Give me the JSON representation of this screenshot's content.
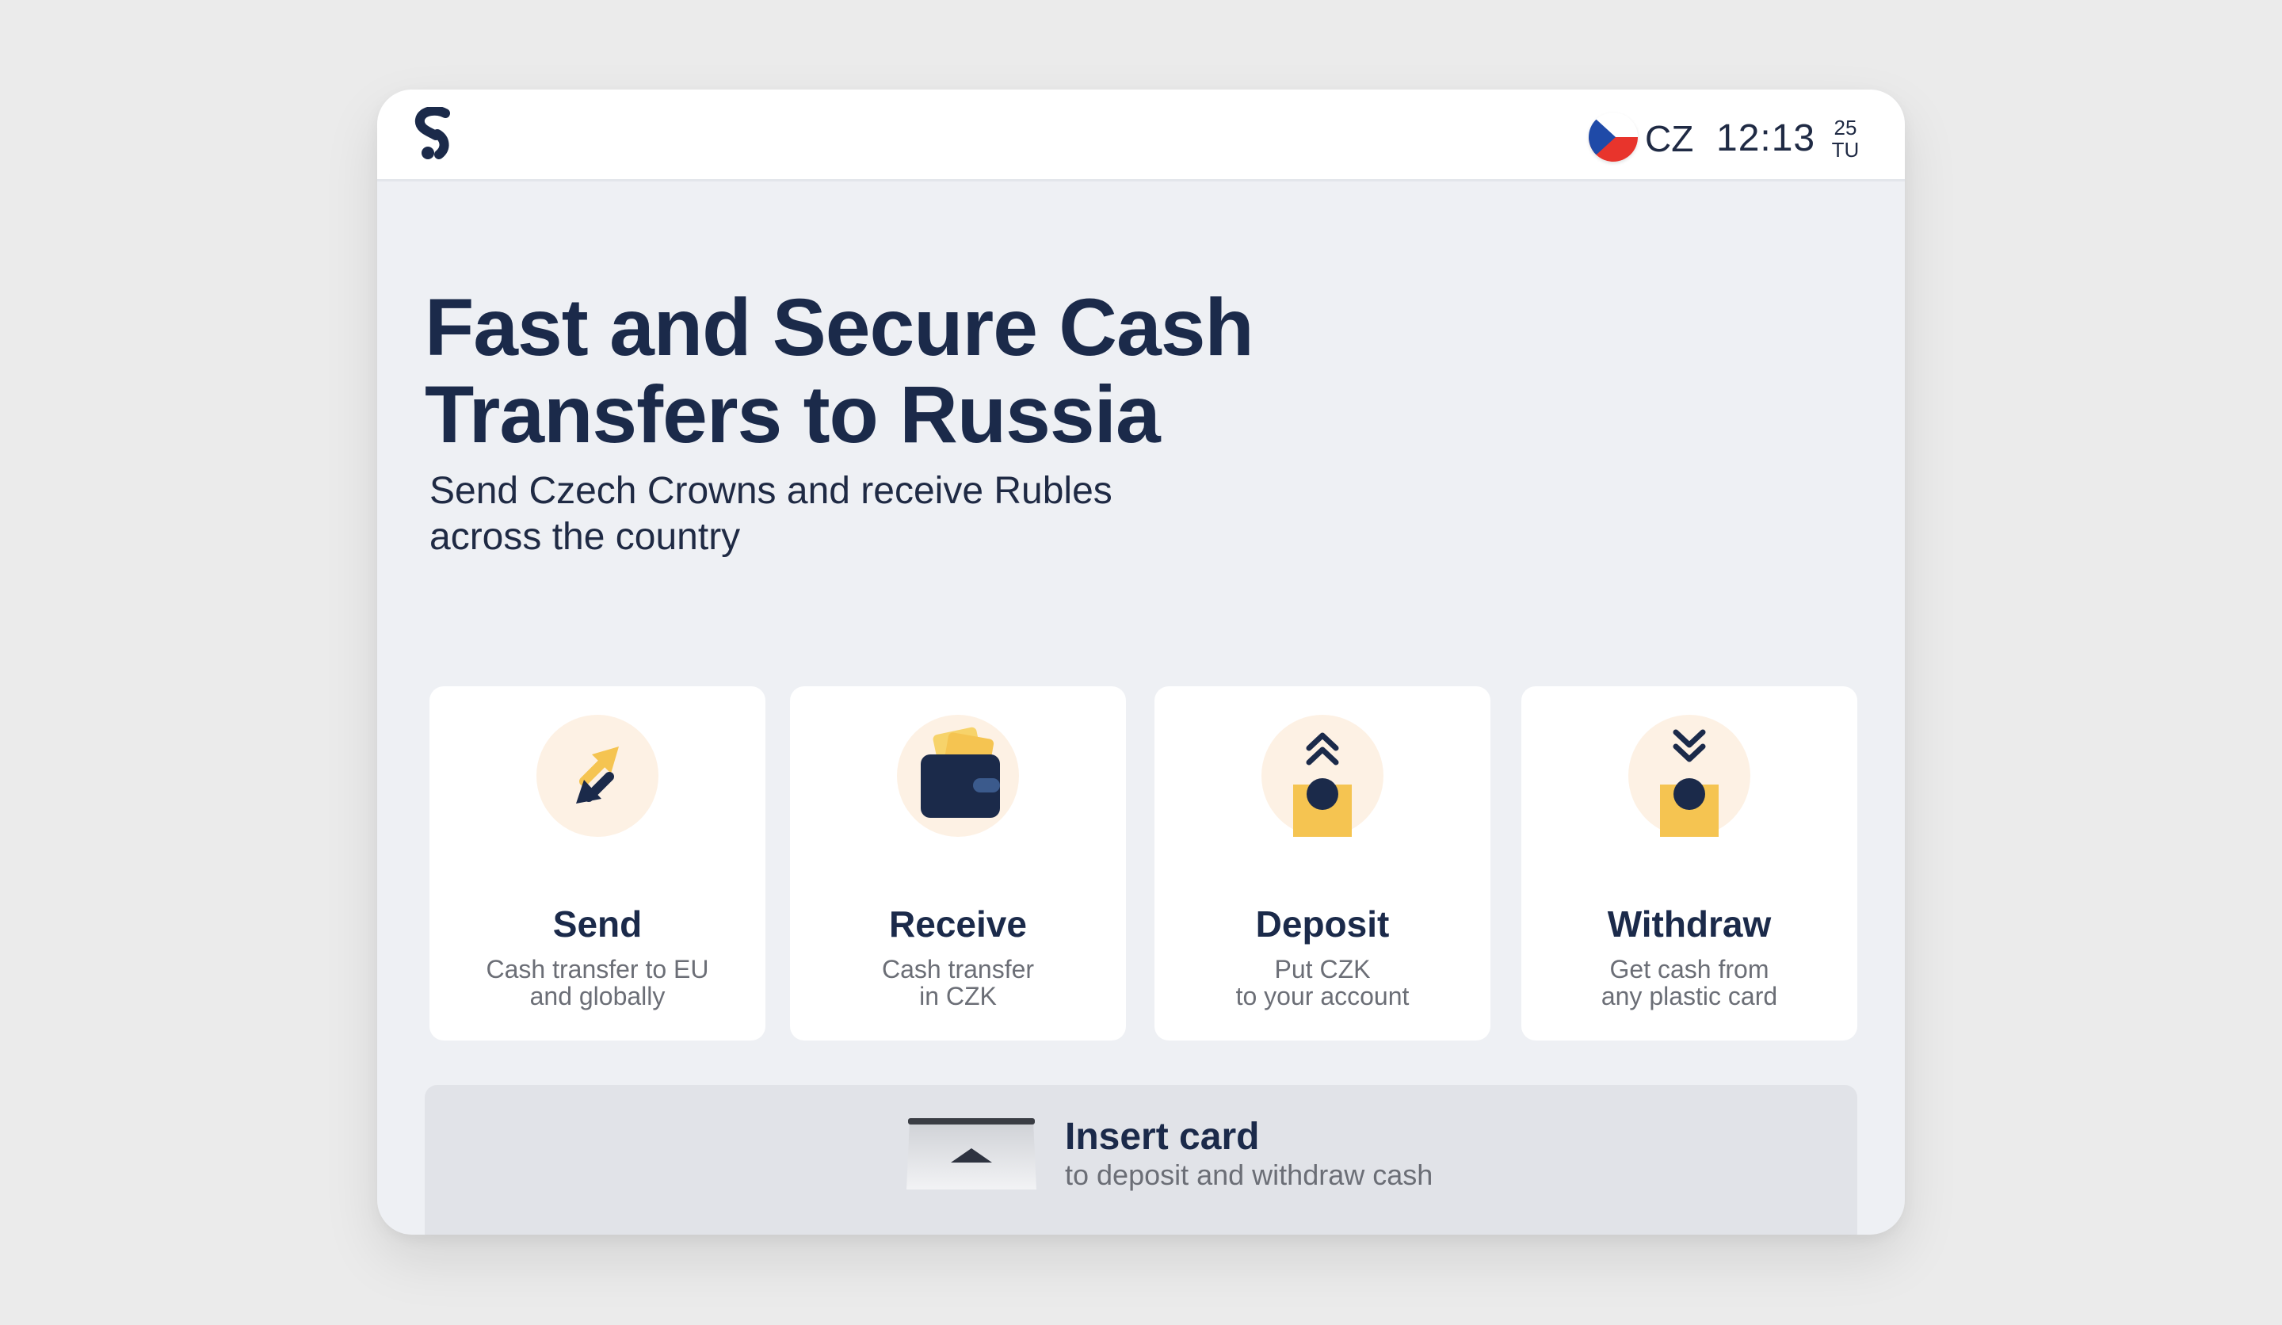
{
  "header": {
    "logo_icon": "s-logo-icon",
    "flag_icon": "czech-flag-icon",
    "language": "CZ",
    "time": "12:13",
    "date_day": "25",
    "date_weekday": "TU"
  },
  "hero": {
    "title": "Fast and Secure Cash Transfers to Russia",
    "subtitle": "Send Czech Crowns and receive Rubles across the country"
  },
  "services": [
    {
      "title": "Send",
      "description": "Cash transfer to EU\nand globally",
      "icon": "send-arrows-icon"
    },
    {
      "title": "Receive",
      "description": "Cash transfer\nin CZK",
      "icon": "wallet-icon"
    },
    {
      "title": "Deposit",
      "description": "Put CZK\nto your account",
      "icon": "deposit-icon"
    },
    {
      "title": "Withdraw",
      "description": "Get cash from\nany plastic card",
      "icon": "withdraw-icon"
    }
  ],
  "insert_card": {
    "title": "Insert card",
    "subtitle": "to deposit and withdraw cash",
    "icon": "card-slot-icon"
  },
  "colors": {
    "navy": "#1b2a4a",
    "accent_yellow": "#f5c451",
    "icon_bg": "#fdf1e4",
    "screen_bg": "#eef0f4"
  }
}
